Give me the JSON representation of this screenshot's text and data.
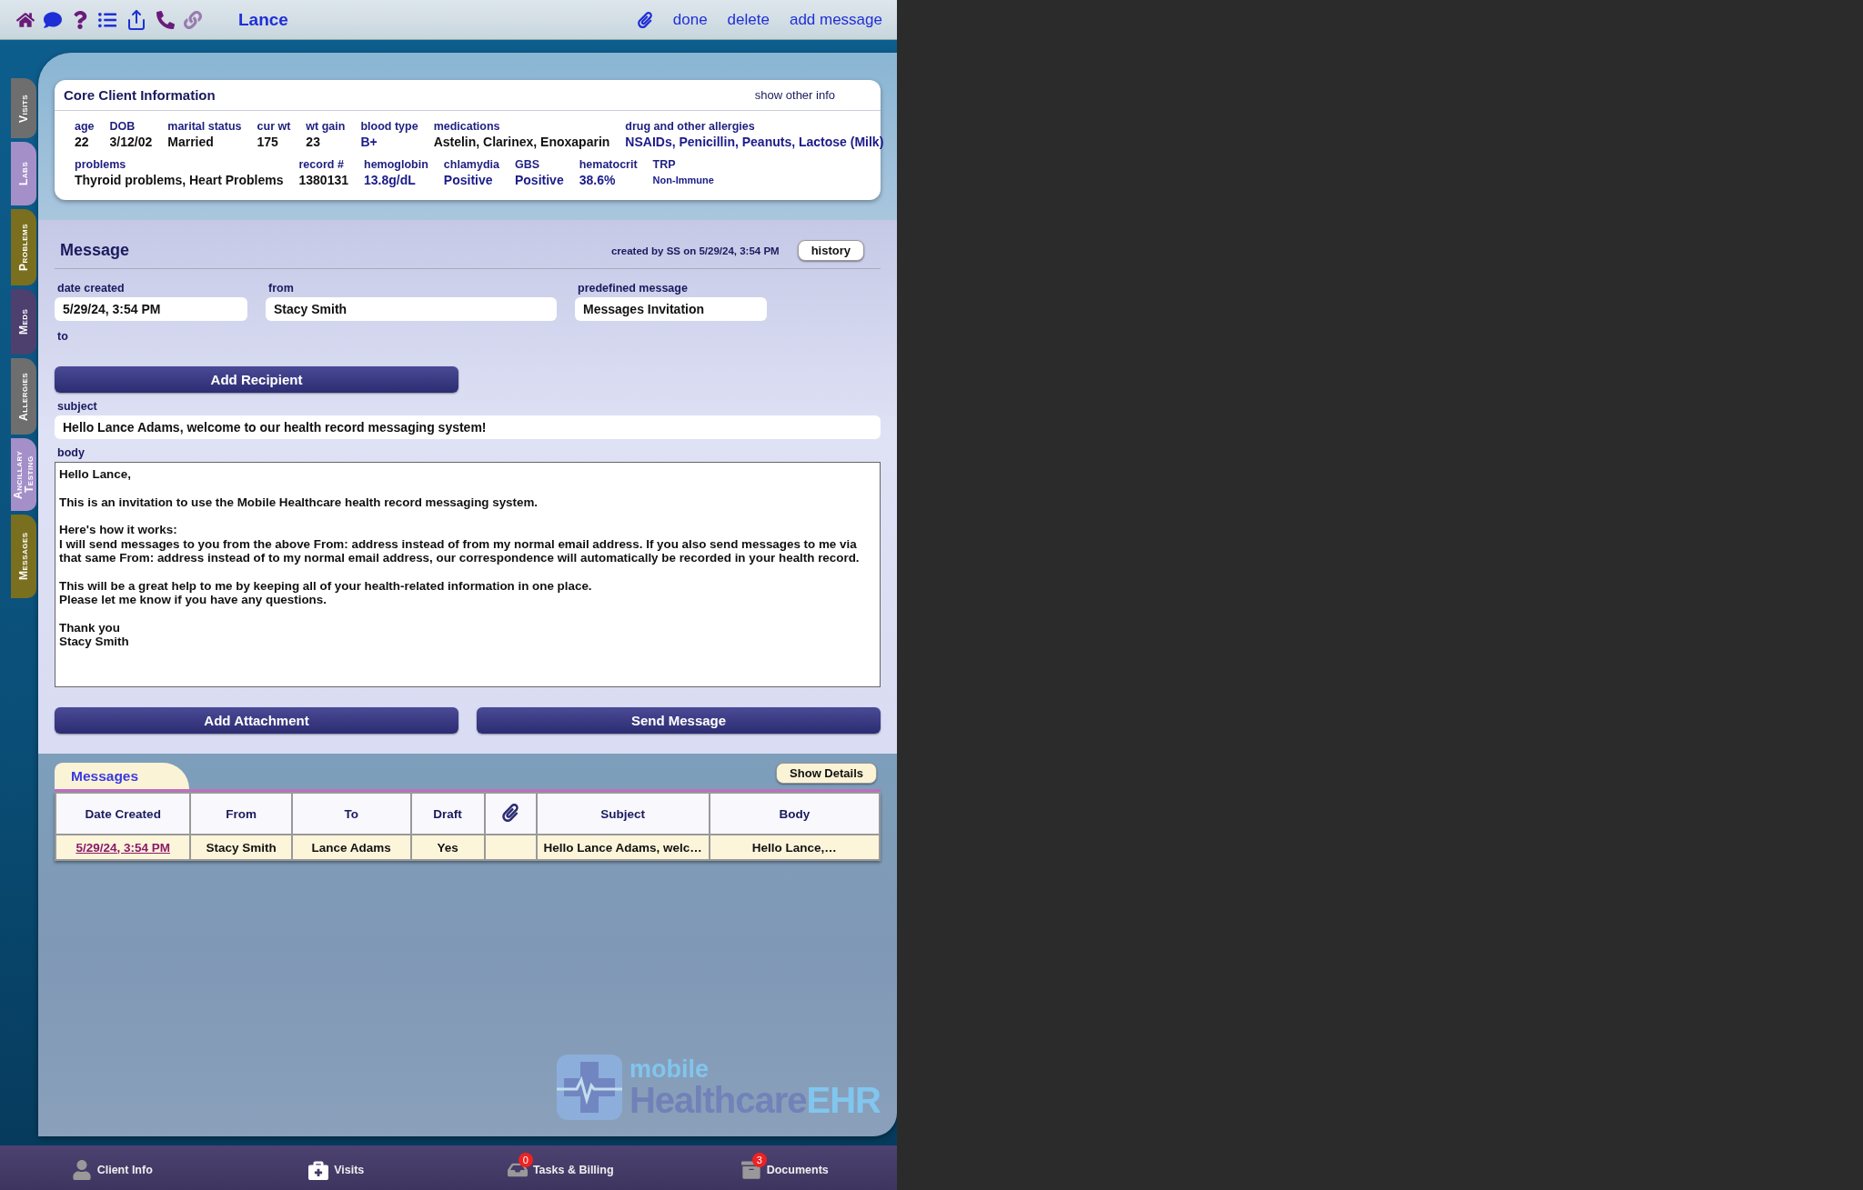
{
  "toolbar": {
    "title": "Lance",
    "actions": [
      "done",
      "delete",
      "add message"
    ]
  },
  "side_tabs": [
    {
      "label": "Visits",
      "color": "#6e6e6e"
    },
    {
      "label": "Labs",
      "color": "#a48fc9"
    },
    {
      "label": "Problems",
      "color": "#7a6f1e"
    },
    {
      "label": "Meds",
      "color": "#4d3f6e"
    },
    {
      "label": "Allergies",
      "color": "#6e6e6e"
    },
    {
      "label": "Ancillary Testing",
      "color": "#a48fc9"
    },
    {
      "label": "Messages",
      "color": "#7a6f1e"
    }
  ],
  "core_info": {
    "title": "Core Client Information",
    "link": "show other info",
    "rows": [
      {
        "fields": [
          {
            "label": "age",
            "value": "22",
            "kind": "plain"
          },
          {
            "label": "DOB",
            "value": "3/12/02",
            "kind": "plain"
          },
          {
            "label": "marital status",
            "value": "Married",
            "kind": "plain"
          },
          {
            "label": "cur wt",
            "value": "175",
            "kind": "plain"
          },
          {
            "label": "wt gain",
            "value": "23",
            "kind": "plain"
          },
          {
            "label": "blood type",
            "value": "B+",
            "kind": "highlight"
          },
          {
            "label": "medications",
            "value": "Astelin, Clarinex, Enoxaparin",
            "kind": "plain"
          },
          {
            "label": "drug and other allergies",
            "value": "NSAIDs, Penicillin, Peanuts, Lactose (Milk)",
            "kind": "highlight"
          }
        ]
      },
      {
        "fields": [
          {
            "label": "problems",
            "value": "Thyroid problems, Heart Problems",
            "kind": "plain"
          },
          {
            "label": "record #",
            "value": "1380131",
            "kind": "plain"
          },
          {
            "label": "hemoglobin",
            "value": "13.8g/dL",
            "kind": "highlight"
          },
          {
            "label": "chlamydia",
            "value": "Positive",
            "kind": "highlight"
          },
          {
            "label": "GBS",
            "value": "Positive",
            "kind": "highlight"
          },
          {
            "label": "hematocrit",
            "value": "38.6%",
            "kind": "highlight"
          },
          {
            "label": "TRP",
            "value": "Non-Immune",
            "kind": "small"
          }
        ]
      }
    ]
  },
  "message": {
    "title": "Message",
    "created_note": "created by SS on 5/29/24, 3:54 PM",
    "history_button": "history",
    "fields": [
      {
        "label": "date created",
        "value": "5/29/24, 3:54 PM"
      },
      {
        "label": "from",
        "value": "Stacy Smith"
      },
      {
        "label": "predefined message",
        "value": "Messages Invitation"
      }
    ],
    "to_label": "to",
    "add_recipient": "Add Recipient",
    "subject": {
      "label": "subject",
      "value": "Hello Lance Adams, welcome to our health record messaging system!"
    },
    "body": {
      "label": "body",
      "paragraphs": [
        [
          "Hello Lance,"
        ],
        [
          "This is an invitation to use the Mobile Healthcare health record messaging system."
        ],
        [
          "Here's how it works:",
          "I will send messages to you from the above From: address instead of from my normal email address.  If you also send messages to me via that same From: address instead of to my normal email address, our correspondence will automatically be recorded in your health record."
        ],
        [
          "This will be a great help to me by keeping all of your health-related information in one place.",
          "Please let me know if you have any questions."
        ],
        [
          "Thank you",
          "Stacy Smith"
        ]
      ]
    },
    "buttons": [
      "Add Attachment",
      "Send Message"
    ]
  },
  "messages": {
    "tab": "Messages",
    "show_details": "Show Details",
    "columns": [
      {
        "kind": "text",
        "label": "Date Created"
      },
      {
        "kind": "text",
        "label": "From"
      },
      {
        "kind": "text",
        "label": "To"
      },
      {
        "kind": "text",
        "label": "Draft"
      },
      {
        "kind": "attachment"
      },
      {
        "kind": "text",
        "label": "Subject"
      },
      {
        "kind": "text",
        "label": "Body"
      }
    ],
    "rows": [
      {
        "date_created": "5/29/24, 3:54 PM",
        "from": "Stacy Smith",
        "to": "Lance Adams",
        "draft": "Yes",
        "subject": "Hello Lance Adams, welc…",
        "body": "Hello Lance,…"
      }
    ]
  },
  "logo": {
    "small": "mobile",
    "main": "Healthcare",
    "accent": "EHR"
  },
  "bottom_tabs": [
    {
      "label": "Client Info",
      "kind": "person"
    },
    {
      "label": "Visits",
      "kind": "kit"
    },
    {
      "label": "Tasks & Billing",
      "kind": "tray",
      "badge": "0"
    },
    {
      "label": "Documents",
      "kind": "cabinet",
      "badge": "3"
    }
  ]
}
